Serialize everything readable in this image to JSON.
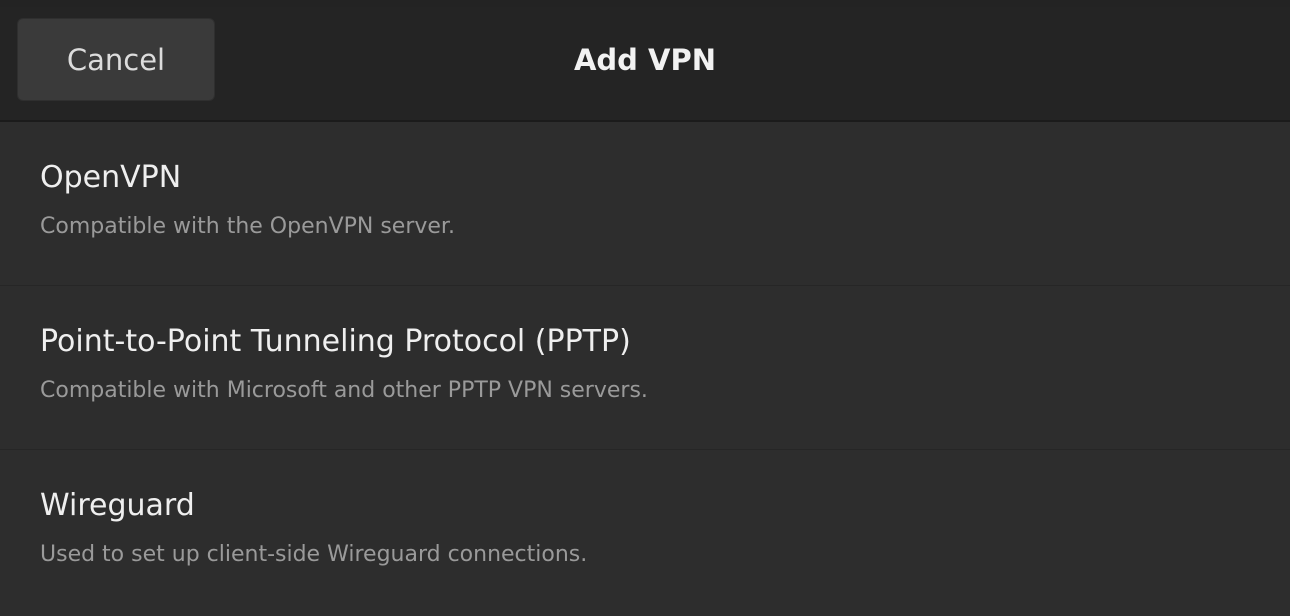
{
  "header": {
    "cancel_label": "Cancel",
    "title": "Add VPN"
  },
  "vpn_options": [
    {
      "title": "OpenVPN",
      "description": "Compatible with the OpenVPN server."
    },
    {
      "title": "Point-to-Point Tunneling Protocol (PPTP)",
      "description": "Compatible with Microsoft and other PPTP VPN servers."
    },
    {
      "title": "Wireguard",
      "description": "Used to set up client-side Wireguard connections."
    }
  ],
  "colors": {
    "header_bg": "#242424",
    "list_bg": "#2d2d2d",
    "button_bg": "#3a3a3a",
    "primary_text": "#efefef",
    "secondary_text": "#9a9a9a"
  }
}
